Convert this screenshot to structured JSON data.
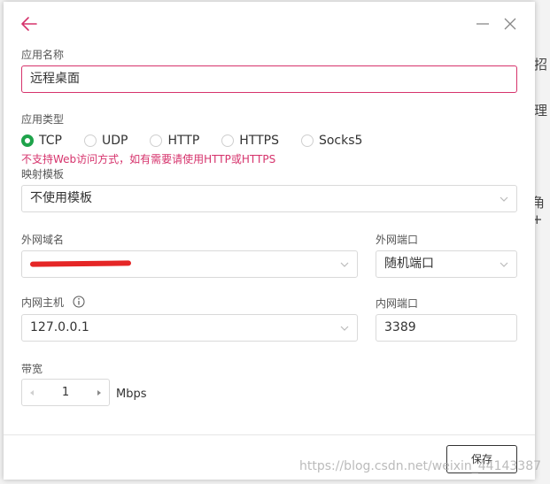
{
  "background": {
    "fragments": [
      "招",
      "理",
      "角+"
    ]
  },
  "dialog": {
    "app_name": {
      "label": "应用名称",
      "value": "远程桌面"
    },
    "app_type": {
      "label": "应用类型",
      "options": [
        "TCP",
        "UDP",
        "HTTP",
        "HTTPS",
        "Socks5"
      ],
      "selected": "TCP",
      "warning": "不支持Web访问方式，如有需要请使用HTTP或HTTPS"
    },
    "mapping_template": {
      "label": "映射模板",
      "value": "不使用模板"
    },
    "external_domain": {
      "label": "外网域名",
      "value": ""
    },
    "external_port": {
      "label": "外网端口",
      "value": "随机端口"
    },
    "internal_host": {
      "label": "内网主机",
      "value": "127.0.0.1"
    },
    "internal_port": {
      "label": "内网端口",
      "value": "3389"
    },
    "bandwidth": {
      "label": "带宽",
      "value": "1",
      "unit": "Mbps"
    },
    "save_label": "保存"
  },
  "watermark": "https://blog.csdn.net/weixin_44143387",
  "colors": {
    "accent": "#d6336c",
    "radio_checked": "#1ea34a",
    "warning": "#d6336c"
  }
}
